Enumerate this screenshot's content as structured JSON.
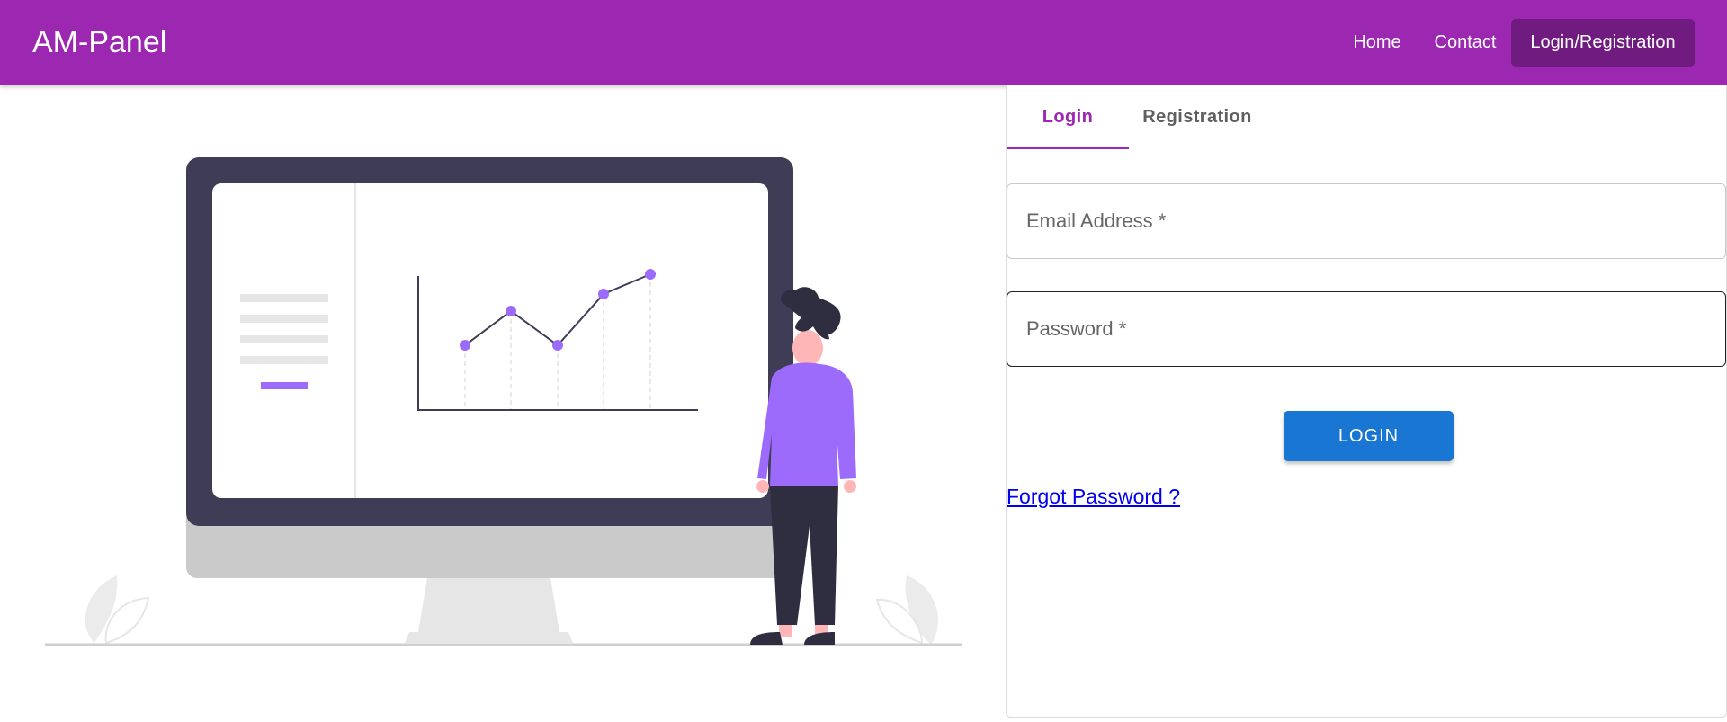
{
  "header": {
    "brand": "AM-Panel",
    "nav": {
      "home": "Home",
      "contact": "Contact",
      "login_registration": "Login/Registration"
    },
    "color": "#9c27b0",
    "active_color": "#6f1b80"
  },
  "auth": {
    "tabs": {
      "login": "Login",
      "registration": "Registration"
    },
    "active_tab": "Login",
    "fields": {
      "email_label": "Email Address *",
      "password_label": "Password *"
    },
    "login_button": "LOGIN",
    "forgot_link": "Forgot Password ?"
  },
  "illustration": {
    "description_icon": "dashboard-presentation-illustration",
    "accent": "#9d6bfb",
    "screen_frame": "#3f3d56"
  }
}
